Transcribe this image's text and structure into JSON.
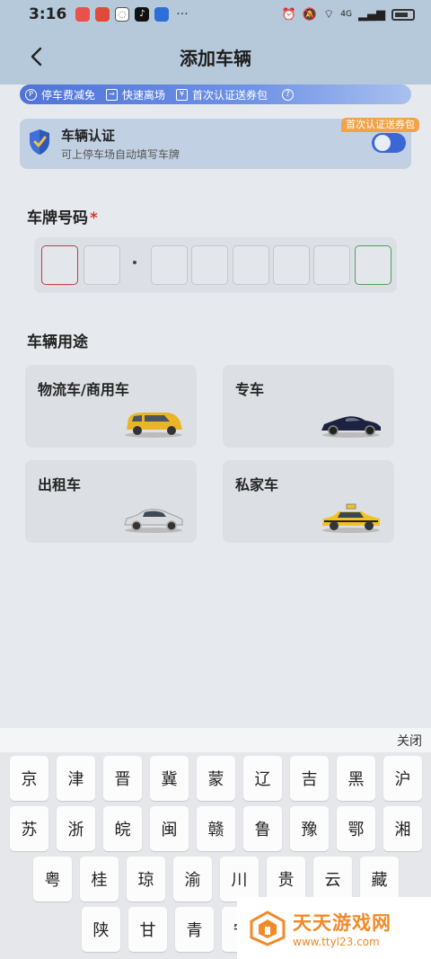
{
  "status_bar": {
    "time": "3:16",
    "apps": [
      {
        "icon": "app-icon-red",
        "color": "#e8524a"
      },
      {
        "icon": "app-icon-orange-red",
        "color": "#e14a3a"
      },
      {
        "icon": "wechat-icon",
        "color": "#555555"
      },
      {
        "icon": "tiktok-icon",
        "color": "#111111"
      },
      {
        "icon": "app-icon-blue",
        "color": "#2d6fd6"
      }
    ],
    "more": "···",
    "network_label": "4G"
  },
  "header": {
    "title": "添加车辆"
  },
  "benefits": [
    {
      "icon": "parking-icon",
      "label": "停车费减免"
    },
    {
      "icon": "exit-icon",
      "label": "快速离场"
    },
    {
      "icon": "coupon-icon",
      "label": "首次认证送券包"
    }
  ],
  "verify": {
    "title": "车辆认证",
    "description": "可上停车场自动填写车牌",
    "badge": "首次认证送券包",
    "enabled": true
  },
  "plate": {
    "label": "车牌号码",
    "required_mark": "*"
  },
  "usage": {
    "label": "车辆用途",
    "options": [
      {
        "label": "物流车/商用车",
        "car": "yellow-van"
      },
      {
        "label": "专车",
        "car": "dark-sports-car"
      },
      {
        "label": "出租车",
        "car": "silver-sedan"
      },
      {
        "label": "私家车",
        "car": "yellow-taxi"
      }
    ]
  },
  "keyboard": {
    "close_label": "关闭",
    "rows": [
      [
        "京",
        "津",
        "晋",
        "冀",
        "蒙",
        "辽",
        "吉",
        "黑",
        "沪"
      ],
      [
        "苏",
        "浙",
        "皖",
        "闽",
        "赣",
        "鲁",
        "豫",
        "鄂",
        "湘"
      ],
      [
        "粤",
        "桂",
        "琼",
        "渝",
        "川",
        "贵",
        "云",
        "藏"
      ],
      [
        "陕",
        "甘",
        "青",
        "宁"
      ]
    ]
  },
  "watermark": {
    "title": "天天游戏网",
    "url": "www.ttyl23.com"
  },
  "colors": {
    "accent": "#3c66d6",
    "required": "#dd3333",
    "badge": "#f0a34a",
    "plate_active": "#c83844",
    "plate_green": "#4fa05a",
    "watermark": "#f08a2a"
  }
}
